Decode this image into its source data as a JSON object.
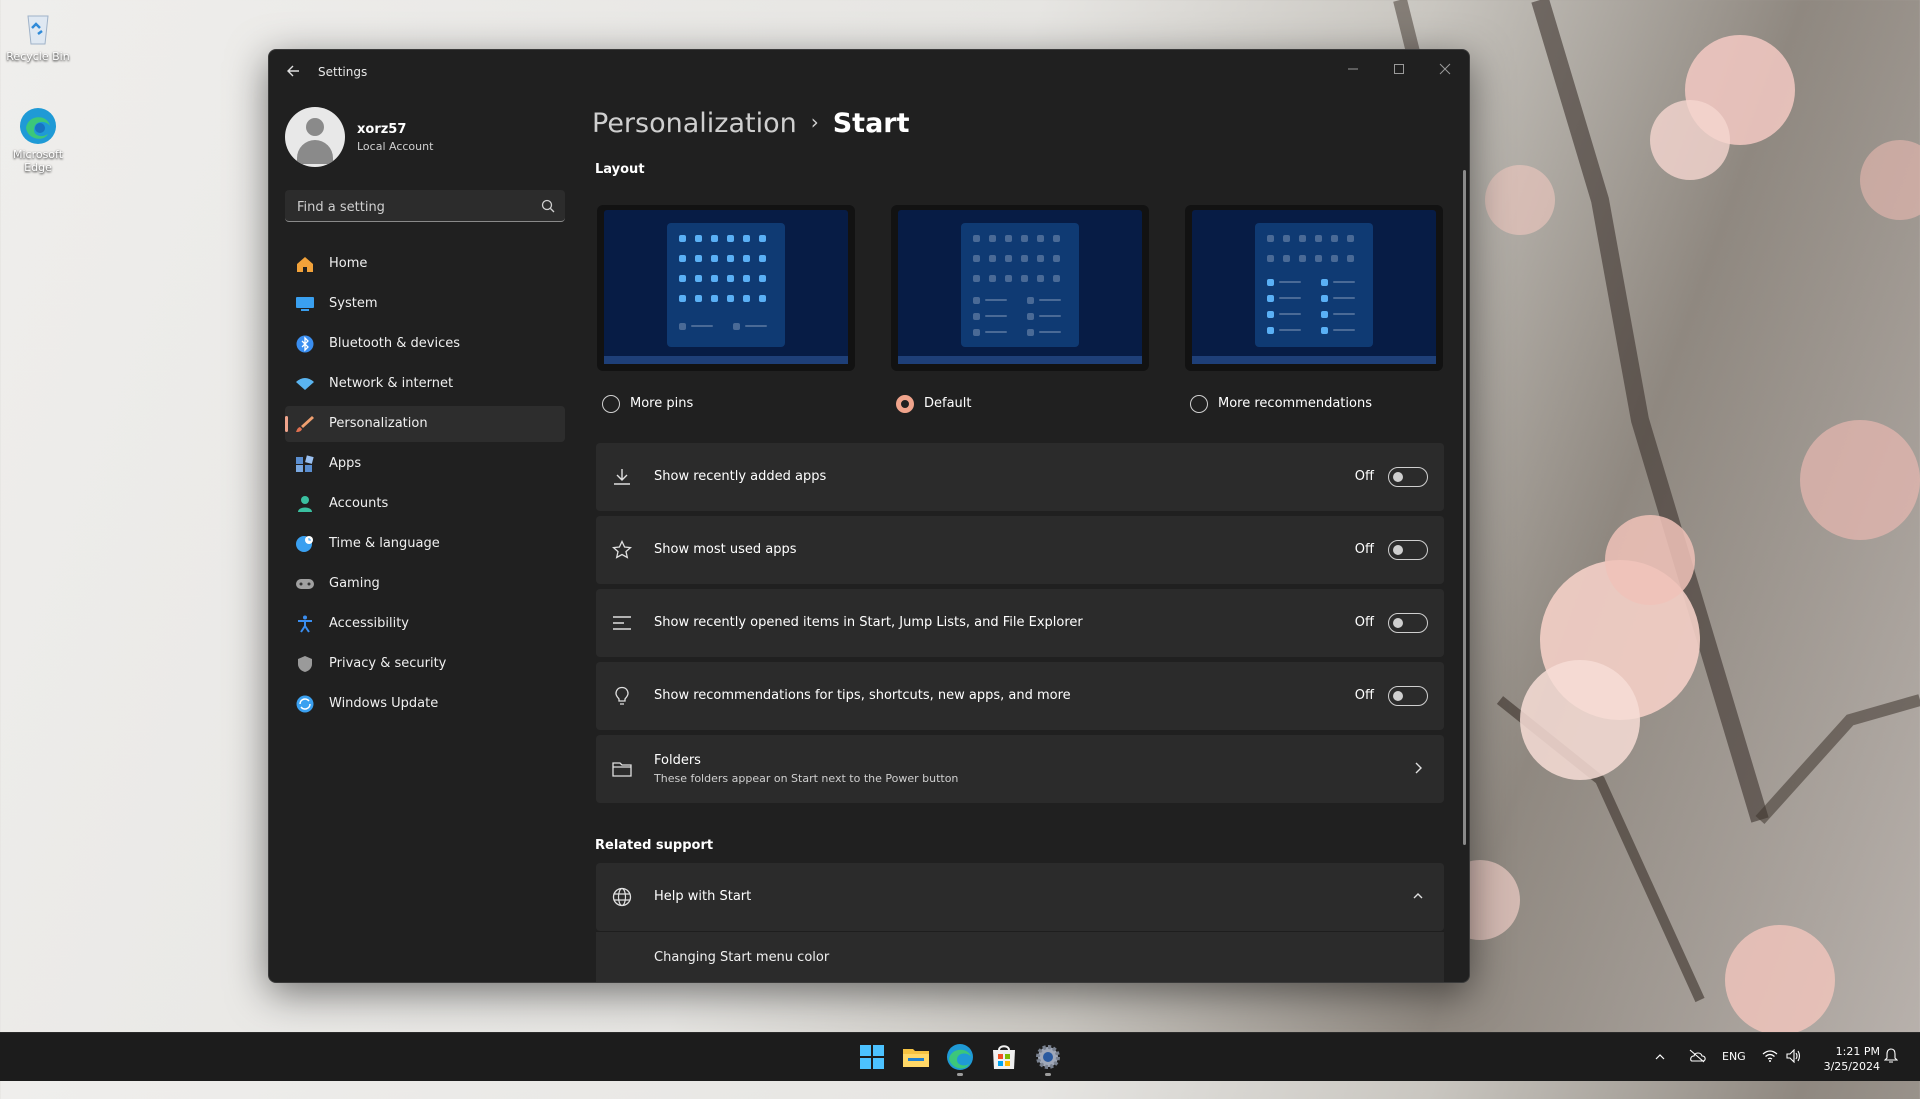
{
  "desktop": {
    "icons": [
      {
        "label": "Recycle Bin",
        "icon": "recycle-bin-icon"
      },
      {
        "label": "Microsoft Edge",
        "icon": "edge-icon"
      }
    ]
  },
  "window": {
    "title": "Settings",
    "controls": [
      "minimize-icon",
      "maximize-icon",
      "close-icon"
    ]
  },
  "user": {
    "name": "xorz57",
    "account_type": "Local Account"
  },
  "search": {
    "placeholder": "Find a setting"
  },
  "nav": {
    "items": [
      {
        "label": "Home",
        "icon": "home-icon",
        "color": "#f2a23a"
      },
      {
        "label": "System",
        "icon": "system-icon",
        "color": "#3aa0f0"
      },
      {
        "label": "Bluetooth & devices",
        "icon": "bluetooth-icon",
        "color": "#3a8ef0"
      },
      {
        "label": "Network & internet",
        "icon": "wifi-icon",
        "color": "#5ab4f0"
      },
      {
        "label": "Personalization",
        "icon": "brush-icon",
        "color": "#f0a070",
        "active": true
      },
      {
        "label": "Apps",
        "icon": "apps-icon",
        "color": "#5a8ed0"
      },
      {
        "label": "Accounts",
        "icon": "accounts-icon",
        "color": "#3ac0a0"
      },
      {
        "label": "Time & language",
        "icon": "globe-clock-icon",
        "color": "#3aa0f0"
      },
      {
        "label": "Gaming",
        "icon": "gaming-icon",
        "color": "#a0a0a0"
      },
      {
        "label": "Accessibility",
        "icon": "accessibility-icon",
        "color": "#3a8ef0"
      },
      {
        "label": "Privacy & security",
        "icon": "shield-icon",
        "color": "#9a9a9a"
      },
      {
        "label": "Windows Update",
        "icon": "update-icon",
        "color": "#3aa0f0"
      }
    ]
  },
  "main": {
    "breadcrumb": {
      "parent": "Personalization",
      "separator": "›",
      "current": "Start"
    },
    "layout_section": "Layout",
    "layout_options": [
      {
        "label": "More pins",
        "selected": false
      },
      {
        "label": "Default",
        "selected": true
      },
      {
        "label": "More recommendations",
        "selected": false
      }
    ],
    "settings": [
      {
        "title": "Show recently added apps",
        "state": "Off",
        "icon": "download-icon"
      },
      {
        "title": "Show most used apps",
        "state": "Off",
        "icon": "star-icon"
      },
      {
        "title": "Show recently opened items in Start, Jump Lists, and File Explorer",
        "state": "Off",
        "icon": "list-icon"
      },
      {
        "title": "Show recommendations for tips, shortcuts, new apps, and more",
        "state": "Off",
        "icon": "lightbulb-icon"
      }
    ],
    "folders": {
      "title": "Folders",
      "subtitle": "These folders appear on Start next to the Power button",
      "icon": "folder-icon"
    },
    "related_support": "Related support",
    "help": {
      "title": "Help with Start",
      "icon": "globe-icon",
      "link": "Changing Start menu color"
    }
  },
  "taskbar": {
    "apps": [
      "windows-start-icon",
      "file-explorer-icon",
      "edge-icon",
      "microsoft-store-icon",
      "settings-gear-icon"
    ],
    "tray": {
      "language": "ENG",
      "time": "1:21 PM",
      "date": "3/25/2024"
    }
  },
  "colors": {
    "accent": "#f0a48c",
    "window_bg": "#202020",
    "card_bg": "#2b2b2b"
  }
}
